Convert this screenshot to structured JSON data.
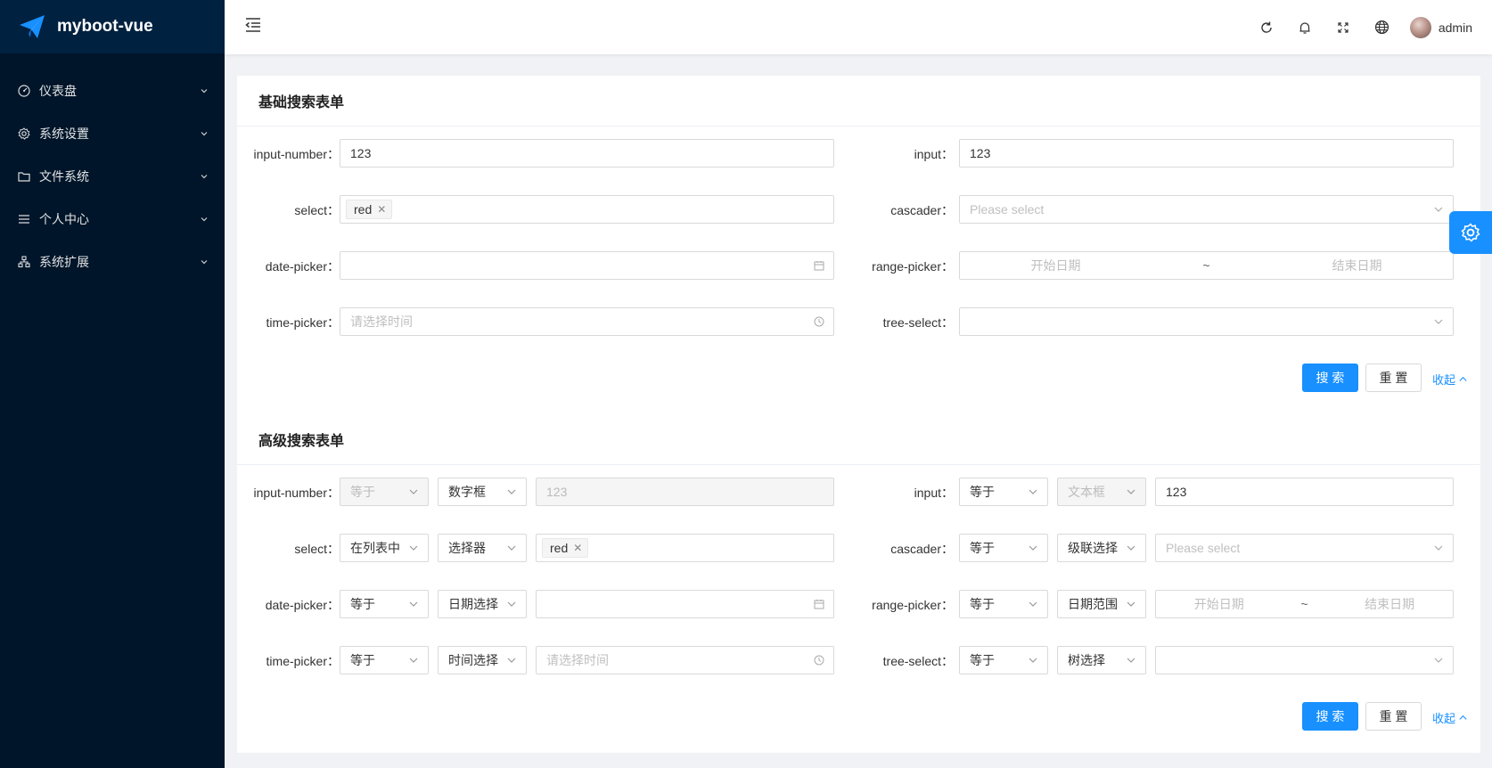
{
  "app": {
    "title": "myboot-vue"
  },
  "sidebar": {
    "items": [
      {
        "label": "仪表盘",
        "icon": "dashboard-icon"
      },
      {
        "label": "系统设置",
        "icon": "gear-icon"
      },
      {
        "label": "文件系统",
        "icon": "folder-icon"
      },
      {
        "label": "个人中心",
        "icon": "list-icon"
      },
      {
        "label": "系统扩展",
        "icon": "cluster-icon"
      }
    ]
  },
  "header": {
    "username": "admin"
  },
  "basic": {
    "title": "基础搜索表单",
    "labels": {
      "input_number": "input-number：",
      "input": "input：",
      "select": "select：",
      "cascader": "cascader：",
      "date_picker": "date-picker：",
      "range_picker": "range-picker：",
      "time_picker": "time-picker：",
      "tree_select": "tree-select："
    },
    "values": {
      "input_number": "123",
      "input": "123",
      "select_tag": "red",
      "cascader_placeholder": "Please select",
      "range_start": "开始日期",
      "range_sep": "~",
      "range_end": "结束日期",
      "time_placeholder": "请选择时间"
    },
    "buttons": {
      "search": "搜 索",
      "reset": "重 置",
      "collapse": "收起"
    }
  },
  "advanced": {
    "title": "高级搜索表单",
    "labels": {
      "input_number": "input-number：",
      "input": "input：",
      "select": "select：",
      "cascader": "cascader：",
      "date_picker": "date-picker：",
      "range_picker": "range-picker：",
      "time_picker": "time-picker：",
      "tree_select": "tree-select："
    },
    "ops": {
      "input_number": "等于",
      "input": "等于",
      "select": "在列表中",
      "cascader": "等于",
      "date_picker": "等于",
      "range_picker": "等于",
      "time_picker": "等于",
      "tree_select": "等于"
    },
    "types": {
      "input_number": "数字框",
      "input": "文本框",
      "select": "选择器",
      "cascader": "级联选择",
      "date_picker": "日期选择",
      "range_picker": "日期范围",
      "time_picker": "时间选择",
      "tree_select": "树选择"
    },
    "values": {
      "input_number": "123",
      "input": "123",
      "select_tag": "red",
      "cascader_placeholder": "Please select",
      "range_start": "开始日期",
      "range_sep": "~",
      "range_end": "结束日期",
      "time_placeholder": "请选择时间"
    },
    "buttons": {
      "search": "搜 索",
      "reset": "重 置",
      "collapse": "收起"
    }
  },
  "colors": {
    "primary": "#1890ff",
    "sidebar": "#001529",
    "logo_bg": "#002140"
  }
}
